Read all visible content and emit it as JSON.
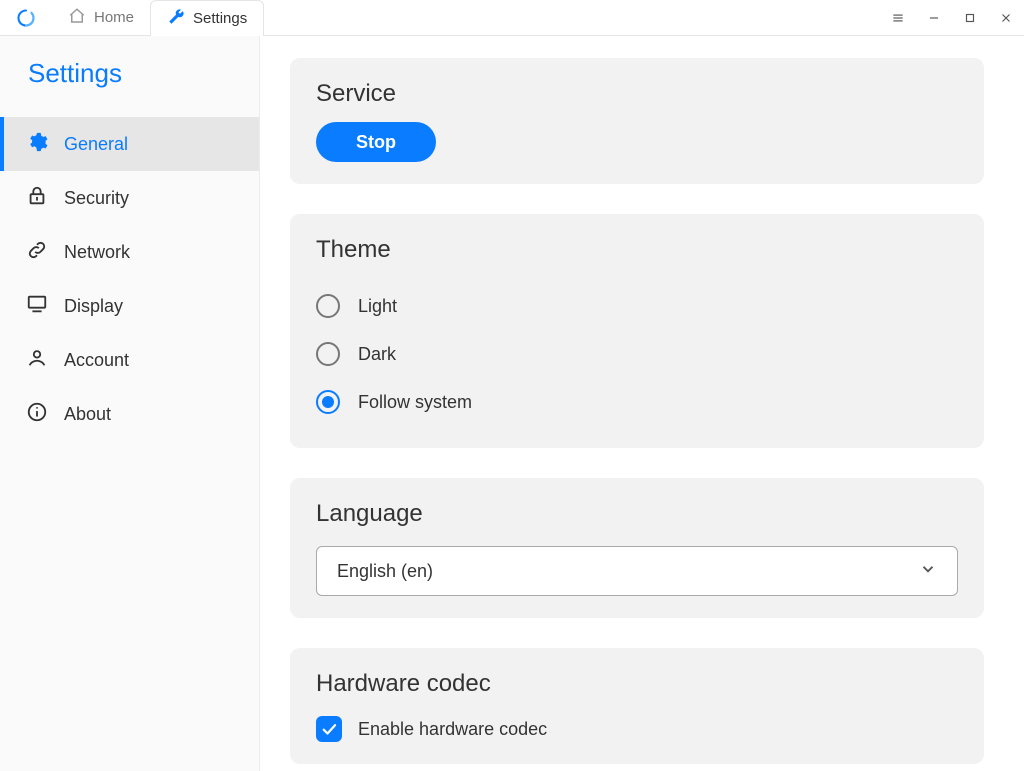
{
  "titlebar": {
    "tabs": [
      {
        "label": "Home"
      },
      {
        "label": "Settings"
      }
    ]
  },
  "sidebar": {
    "title": "Settings",
    "items": [
      {
        "label": "General"
      },
      {
        "label": "Security"
      },
      {
        "label": "Network"
      },
      {
        "label": "Display"
      },
      {
        "label": "Account"
      },
      {
        "label": "About"
      }
    ]
  },
  "service": {
    "title": "Service",
    "button": "Stop"
  },
  "theme": {
    "title": "Theme",
    "options": [
      {
        "label": "Light"
      },
      {
        "label": "Dark"
      },
      {
        "label": "Follow system"
      }
    ],
    "selected_index": 2
  },
  "language": {
    "title": "Language",
    "selected": "English (en)"
  },
  "hwcodec": {
    "title": "Hardware codec",
    "checkbox_label": "Enable hardware codec",
    "checked": true
  }
}
